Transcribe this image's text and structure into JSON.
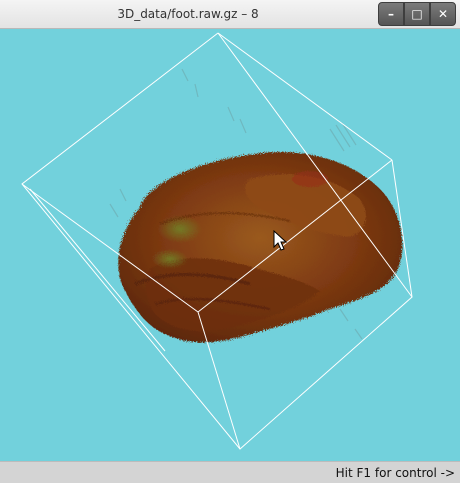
{
  "window": {
    "title": "3D_data/foot.raw.gz – 8",
    "buttons": {
      "minimize_icon": "minimize-icon",
      "maximize_icon": "maximize-icon",
      "close_icon": "close-icon"
    }
  },
  "viewport": {
    "background_color": "#72d1dc",
    "volume_color": "#8a3d12",
    "bounding_box_color": "#ffffff"
  },
  "status": {
    "hint": "Hit F1 for control ->"
  }
}
